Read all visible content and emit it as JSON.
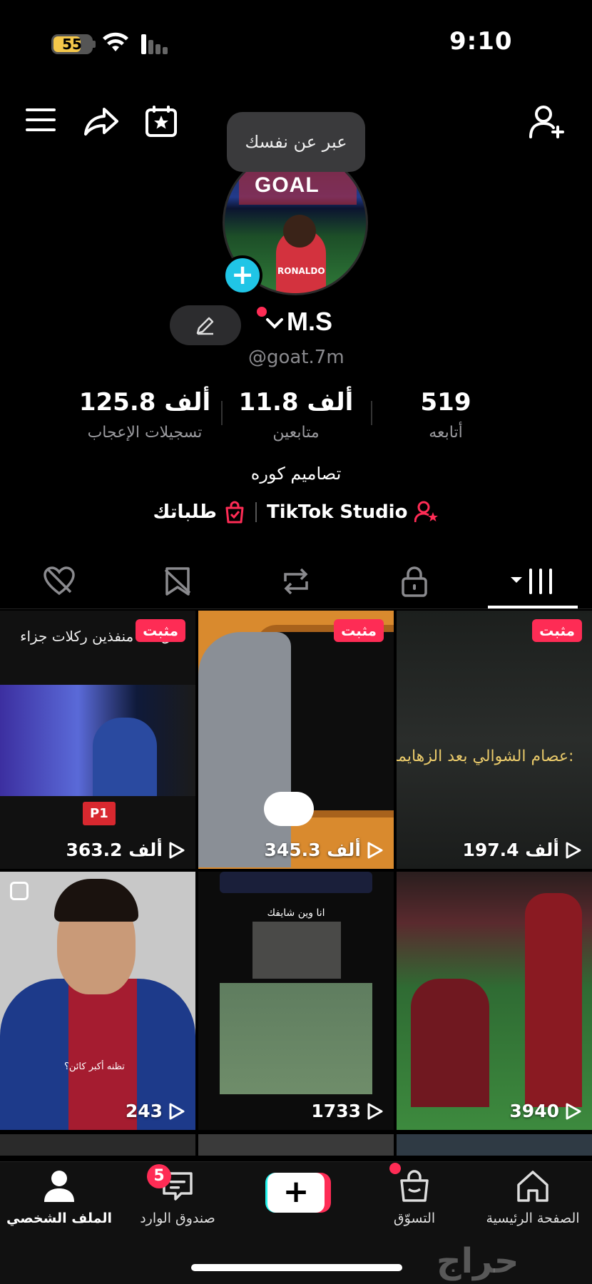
{
  "status_bar": {
    "time": "9:10",
    "battery": "55"
  },
  "tooltip": "عبر عن نفسك",
  "profile": {
    "username": "M.S",
    "handle": "@goat.7m",
    "bio": "تصاميم كوره",
    "stats": {
      "likes_value": "125.8 ألف",
      "likes_label": "تسجيلات الإعجاب",
      "followers_value": "11.8 ألف",
      "followers_label": "متابعين",
      "following_value": "519",
      "following_label": "أتابعه"
    },
    "links": {
      "studio": "TikTok Studio",
      "orders": "طلباتك"
    }
  },
  "avatar_text": {
    "goal": "GOAL",
    "shirt": "RONALDO"
  },
  "tabs": [
    "videos-grid",
    "private",
    "reposts",
    "favorites",
    "liked"
  ],
  "grid": [
    {
      "pinned_label": "مثبت",
      "views": "197.4 ألف",
      "caption": "عصام الشوالي بعد الزهايمر:"
    },
    {
      "pinned_label": "مثبت",
      "views": "345.3 ألف"
    },
    {
      "pinned_label": "مثبت",
      "views": "363.2 ألف",
      "caption": "ل 10 منفذين ركلات جزاء",
      "tag": "P1"
    },
    {
      "views": "3940"
    },
    {
      "views": "1733",
      "caption": "انا وين شايفك"
    },
    {
      "views": "243",
      "caption": "تظنه أكبر كائن؟"
    }
  ],
  "bottom_nav": {
    "home": "الصفحة الرئيسية",
    "shop": "التسوّق",
    "create": "+",
    "inbox": "صندوق الوارد",
    "inbox_badge": "5",
    "profile": "الملف الشخصي"
  },
  "watermark": "حراج",
  "colors": {
    "accent": "#fe2c55",
    "cyan": "#25f4ee",
    "plus_badge": "#20c5e6",
    "pin_badge": "#fe2c55"
  }
}
